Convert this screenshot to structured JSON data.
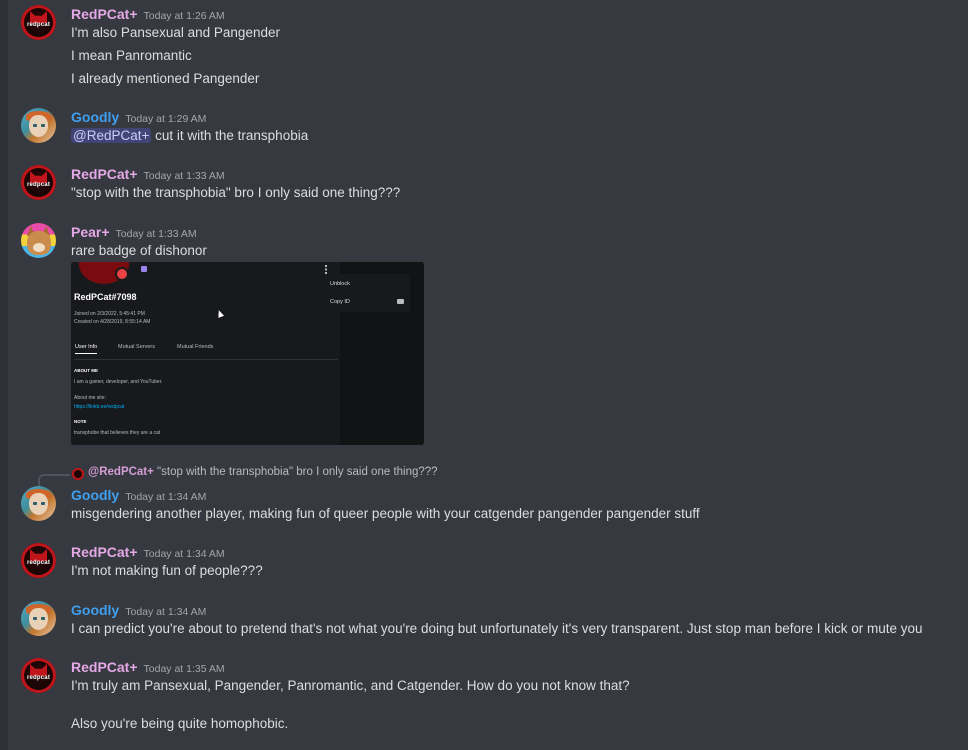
{
  "messages": [
    {
      "author": "RedPCat+",
      "time": "Today at 1:26 AM",
      "lines": [
        "I'm also Pansexual and Pangender",
        "I mean Panromantic",
        "I already mentioned Pangender"
      ]
    },
    {
      "author": "Goodly",
      "time": "Today at 1:29 AM",
      "mention": "@RedPCat+",
      "text": " cut it with the transphobia"
    },
    {
      "author": "RedPCat+",
      "time": "Today at 1:33 AM",
      "text": "\"stop with the transphobia\" bro I only said one thing???"
    },
    {
      "author": "Pear+",
      "time": "Today at 1:33 AM",
      "text": "rare badge of dishonor"
    },
    {
      "author": "Goodly",
      "time": "Today at 1:34 AM",
      "text": "misgendering another player, making fun of queer people with your catgender pangender pangender stuff"
    },
    {
      "author": "RedPCat+",
      "time": "Today at 1:34 AM",
      "text": "I'm not making fun of people???"
    },
    {
      "author": "Goodly",
      "time": "Today at 1:34 AM",
      "text": "I can predict you're about to pretend that's not what you're doing but unfortunately it's very transparent. Just stop man before I kick or mute you"
    },
    {
      "author": "RedPCat+",
      "time": "Today at 1:35 AM",
      "lines": [
        "I'm truly am Pansexual, Pangender, Panromantic, and Catgender. How do you not know that?",
        "Also you're being quite homophobic."
      ]
    }
  ],
  "reply": {
    "name": "@RedPCat+",
    "text": " \"stop with the transphobia\" bro I only said one thing???"
  },
  "embed": {
    "username": "RedPCat#7098",
    "joined": "Joined on 2/3/2022, 5:45:41 PM",
    "created": "Created on 4/28/2019, 8:55:14 AM",
    "tabs": [
      "User Info",
      "Mutual Servers",
      "Mutual Friends"
    ],
    "about_heading": "ABOUT ME",
    "about_text": "I am a gamer, developer, and YouTuber.",
    "about_site": "About me site:",
    "site_link": "https://linktr.ee/redpcat",
    "note_heading": "NOTE",
    "note_text": "transphobe that believes they are a cat",
    "menu": [
      "Unblock",
      "Copy ID"
    ]
  },
  "avatar_text": "redpcat",
  "colors": {
    "bg": "#36393f",
    "red_role": "#e5a8e6",
    "goodly": "#3f9ff0",
    "mention_bg": "#3c4270"
  }
}
